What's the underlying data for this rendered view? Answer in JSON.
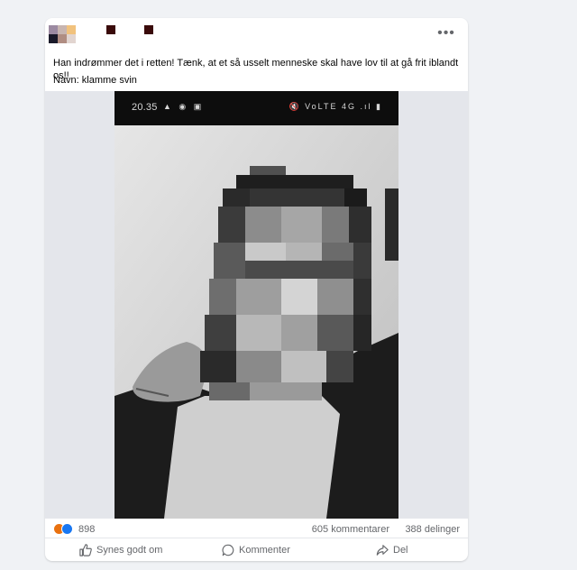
{
  "post": {
    "author_avatar": "pixelated-avatar",
    "more_icon": "more-horizontal-icon",
    "more_label": "•••",
    "text_line1": "Han indrømmer det i retten! Tænk, at et så usselt menneske skal have lov til at gå frit iblandt os!!",
    "text_line2": "Navn: klamme svin",
    "image": {
      "status_time": "20.35",
      "status_icons_left": "▲ ◉ ▣",
      "status_icons_right": "🔇 VoLTE 4G .ıl ▮",
      "photo": "pixelated-face-photo"
    },
    "stats": {
      "reaction_icons": [
        "angry-reaction-icon",
        "like-reaction-icon"
      ],
      "reactions_count": "898",
      "comments": "605 kommentarer",
      "shares": "388 delinger"
    },
    "actions": {
      "like_label": "Synes godt om",
      "comment_label": "Kommenter",
      "share_label": "Del"
    }
  },
  "colors": {
    "background": "#f0f2f5",
    "card": "#ffffff",
    "secondary_text": "#65676b",
    "like_blue": "#1877f2",
    "angry_orange": "#e9710f"
  }
}
